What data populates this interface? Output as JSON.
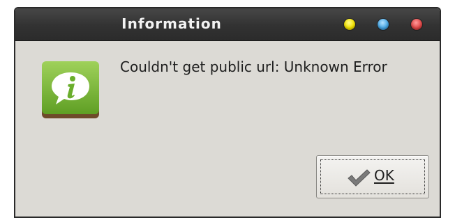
{
  "window": {
    "title": "Information"
  },
  "dialog": {
    "icon": "information-icon",
    "message": "Couldn't get public url: Unknown Error",
    "ok_button": {
      "label": "OK",
      "icon": "checkmark-icon"
    }
  },
  "colors": {
    "titlebar": "#323232",
    "dialog_background": "#dcdad5",
    "info_icon_green": "#74b536",
    "minimize_button": "#f2e200",
    "maximize_button": "#48a7e4",
    "close_button": "#e04848"
  }
}
